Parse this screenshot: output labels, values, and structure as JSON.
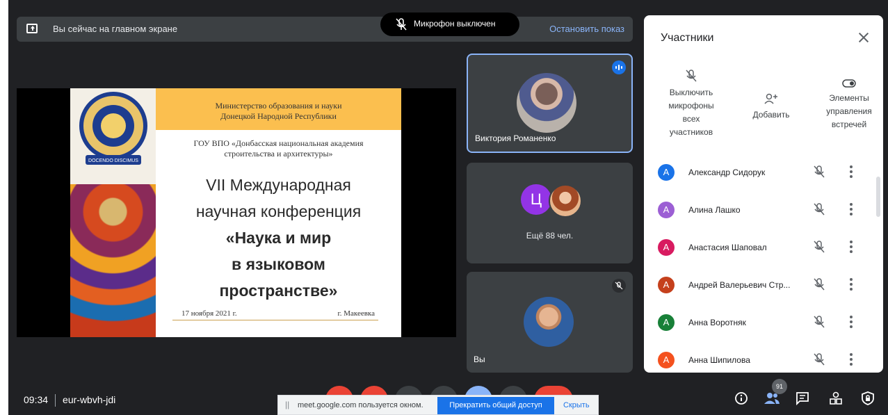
{
  "banner": {
    "presenting_text": "Вы сейчас на главном экране",
    "stop_label": "Остановить показ"
  },
  "mic_status": "Микрофон выключен",
  "slide": {
    "ministry_line1": "Министерство образования и науки",
    "ministry_line2": "Донецкой Народной Республики",
    "uni_line1": "ГОУ ВПО «Донбасская национальная академия",
    "uni_line2": "строительства и архитектуры»",
    "title_line1": "VII Международная",
    "title_line2": "научная конференция",
    "title_line3": "«Наука и мир",
    "title_line4": "в языковом",
    "title_line5": "пространстве»",
    "date": "17 ноября 2021 г.",
    "city": "г. Макеевка",
    "crest_motto": "DOCENDO DISCIMUS"
  },
  "tiles": {
    "speaker_name": "Виктория Романенко",
    "more_initial": "Ц",
    "more_label": "Ещё 88 чел.",
    "self_label": "Вы"
  },
  "panel": {
    "title": "Участники",
    "action_mute_all": [
      "Выключить",
      "микрофоны",
      "всех",
      "участников"
    ],
    "action_add": "Добавить",
    "action_controls": [
      "Элементы",
      "управления",
      "встречей"
    ],
    "participants": [
      {
        "initial": "А",
        "name": "Александр Сидорук",
        "color": "#1a73e8"
      },
      {
        "initial": "А",
        "name": "Алина Лашко",
        "color": "#9c5fd4"
      },
      {
        "initial": "А",
        "name": "Анастасия Шаповал",
        "color": "#d81b60"
      },
      {
        "initial": "А",
        "name": "Андрей Валерьевич Стр...",
        "color": "#c5401c"
      },
      {
        "initial": "А",
        "name": "Анна Воротняк",
        "color": "#188038"
      },
      {
        "initial": "А",
        "name": "Анна Шипилова",
        "color": "#f4511e"
      }
    ]
  },
  "bottom": {
    "time": "09:34",
    "meeting_code": "eur-wbvh-jdi",
    "participants_count": "91"
  },
  "share_bar": {
    "message": "meet.google.com пользуется окном.",
    "stop_label": "Прекратить общий доступ",
    "hide_label": "Скрыть"
  }
}
